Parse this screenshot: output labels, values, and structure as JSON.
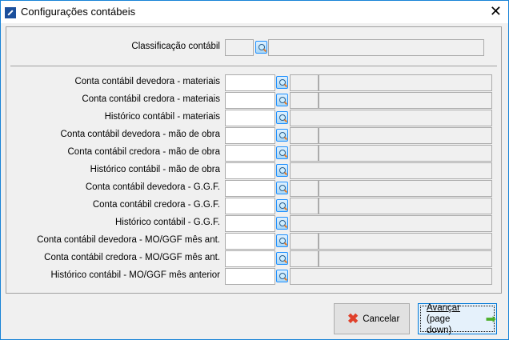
{
  "window": {
    "title": "Configurações contábeis"
  },
  "classificacao": {
    "label": "Classificação contábil"
  },
  "rows": [
    {
      "label": "Conta contábil devedora - materiais",
      "type": "conta"
    },
    {
      "label": "Conta contábil credora - materiais",
      "type": "conta"
    },
    {
      "label": "Histórico contábil - materiais",
      "type": "hist"
    },
    {
      "label": "Conta contábil devedora - mão de obra",
      "type": "conta"
    },
    {
      "label": "Conta contábil credora - mão de obra",
      "type": "conta"
    },
    {
      "label": "Histórico contábil - mão de obra",
      "type": "hist"
    },
    {
      "label": "Conta contábil devedora - G.G.F.",
      "type": "conta"
    },
    {
      "label": "Conta contábil credora - G.G.F.",
      "type": "conta"
    },
    {
      "label": "Histórico contábil - G.G.F.",
      "type": "hist"
    },
    {
      "label": "Conta contábil devedora - MO/GGF mês ant.",
      "type": "conta"
    },
    {
      "label": "Conta contábil credora - MO/GGF mês ant.",
      "type": "conta"
    },
    {
      "label": "Histórico contábil - MO/GGF mês anterior",
      "type": "hist"
    }
  ],
  "buttons": {
    "cancel": "Cancelar",
    "next_line1": "Avançar",
    "next_line2": "(page down)"
  }
}
